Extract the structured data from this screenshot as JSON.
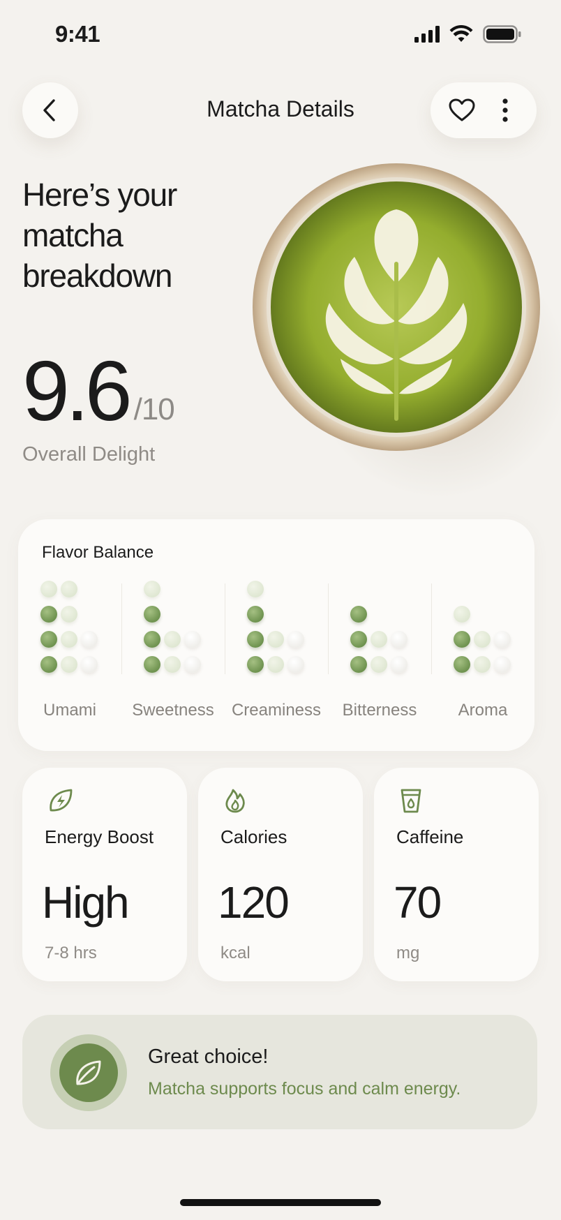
{
  "status_bar": {
    "time": "9:41"
  },
  "header": {
    "title": "Matcha Details"
  },
  "hero": {
    "heading_lines": [
      "Here’s your",
      "matcha",
      "breakdown"
    ],
    "score": "9.6",
    "score_max": "/10",
    "score_label": "Overall Delight"
  },
  "flavor": {
    "title": "Flavor Balance",
    "columns": [
      {
        "label": "Umami",
        "dots": [
          [
            "soft",
            "soft",
            null
          ],
          [
            "on",
            "soft",
            null
          ],
          [
            "on",
            "soft",
            "ghost"
          ],
          [
            "on",
            "soft",
            "ghost"
          ]
        ]
      },
      {
        "label": "Sweetness",
        "dots": [
          [
            "soft",
            null,
            null
          ],
          [
            "on",
            null,
            null
          ],
          [
            "on",
            "soft",
            "ghost"
          ],
          [
            "on",
            "soft",
            "ghost"
          ]
        ]
      },
      {
        "label": "Creaminess",
        "dots": [
          [
            "soft",
            null,
            null
          ],
          [
            "on",
            null,
            null
          ],
          [
            "on",
            "soft",
            "ghost"
          ],
          [
            "on",
            "soft",
            "ghost"
          ]
        ]
      },
      {
        "label": "Bitterness",
        "dots": [
          [
            null,
            null,
            null
          ],
          [
            "on",
            null,
            null
          ],
          [
            "on",
            "soft",
            "ghost"
          ],
          [
            "on",
            "soft",
            "ghost"
          ]
        ]
      },
      {
        "label": "Aroma",
        "dots": [
          [
            null,
            null,
            null
          ],
          [
            "soft",
            null,
            null
          ],
          [
            "on",
            "soft",
            "ghost"
          ],
          [
            "on",
            "soft",
            "ghost"
          ]
        ]
      }
    ]
  },
  "stats": [
    {
      "icon": "energy-leaf-icon",
      "label": "Energy Boost",
      "value": "High",
      "unit": "7-8 hrs"
    },
    {
      "icon": "flame-icon",
      "label": "Calories",
      "value": "120",
      "unit": "kcal"
    },
    {
      "icon": "cup-icon",
      "label": "Caffeine",
      "value": "70",
      "unit": "mg"
    }
  ],
  "banner": {
    "title": "Great choice!",
    "subtitle": "Matcha supports focus and calm energy."
  },
  "colors": {
    "accent": "#6d8a4d",
    "background": "#f4f2ee",
    "card": "#fcfbf9"
  }
}
